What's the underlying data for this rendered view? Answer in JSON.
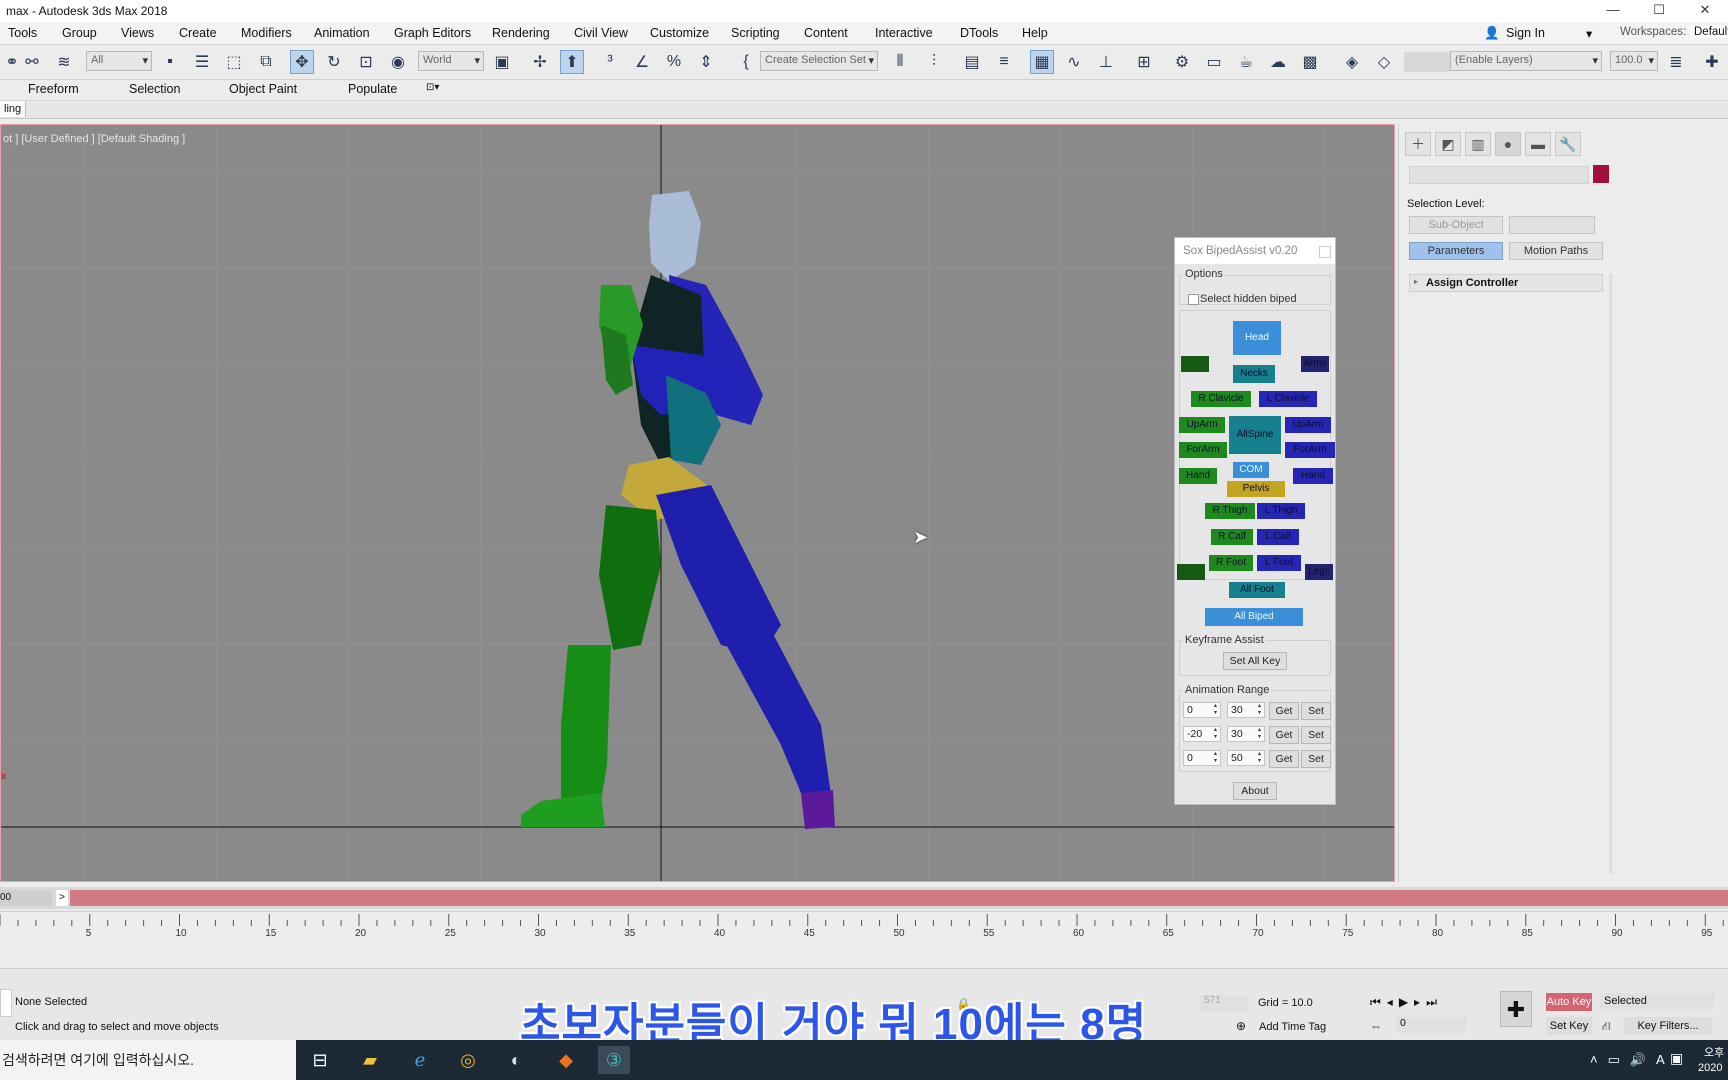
{
  "window": {
    "title": "max - Autodesk 3ds Max 2018"
  },
  "menubar": {
    "items": [
      "Tools",
      "Group",
      "Views",
      "Create",
      "Modifiers",
      "Animation",
      "Graph Editors",
      "Rendering",
      "Civil View",
      "Customize",
      "Scripting",
      "Content",
      "Interactive",
      "DTools",
      "Help"
    ],
    "sign_in": "Sign In",
    "workspaces_label": "Workspaces:",
    "workspaces_value": "Default"
  },
  "toolbar": {
    "filter_value": "All",
    "coord_value": "World",
    "selection_set_placeholder": "Create Selection Set",
    "layers_value": "(Enable Layers)",
    "layers_num": "100.0"
  },
  "ribbon": {
    "items": [
      "Freeform",
      "Selection",
      "Object Paint",
      "Populate"
    ],
    "tab": "ling"
  },
  "viewport": {
    "label": "ot ] [User Defined ] [Default Shading ]"
  },
  "biped_assist": {
    "title": "Sox BipedAssist v0.20",
    "options_label": "Options",
    "select_hidden": "Select hidden biped",
    "buttons": {
      "head": "Head",
      "neck": "Necks",
      "arms": "Arms",
      "r_clavicle": "R Clavicle",
      "l_clavicle": "L Clavicle",
      "r_uparm": "UpArm",
      "l_uparm": "UpArm",
      "allspine": "AllSpine",
      "r_forearm": "ForArm",
      "l_forearm": "ForArm",
      "r_hand": "Hand",
      "l_hand": "Hand",
      "com": "COM",
      "pelvis": "Pelvis",
      "r_thigh": "R Thigh",
      "l_thigh": "L Thigh",
      "r_calf": "R Calf",
      "l_calf": "L Calf",
      "r_foot": "R Foot",
      "l_foot": "L Foot",
      "legs": "Legs",
      "all_foot": "All Foot",
      "all_biped": "All Biped"
    },
    "keyframe_label": "Keyframe Assist",
    "set_all_key": "Set All Key",
    "anim_range_label": "Animation Range",
    "ranges": [
      {
        "start": "0",
        "end": "30"
      },
      {
        "start": "-20",
        "end": "30"
      },
      {
        "start": "0",
        "end": "50"
      }
    ],
    "get_label": "Get",
    "set_label": "Set",
    "about": "About"
  },
  "command_panel": {
    "selection_level": "Selection Level:",
    "sub_object": "Sub-Object",
    "parameters": "Parameters",
    "motion_paths": "Motion Paths",
    "assign_controller": "Assign Controller",
    "swatch_color": "#a0103a"
  },
  "timeline": {
    "slider_value": "00",
    "slider_arrow": ">",
    "ticks": [
      "5",
      "10",
      "15",
      "20",
      "25",
      "30",
      "35",
      "40",
      "45",
      "50",
      "55",
      "60",
      "65",
      "70",
      "75",
      "80",
      "85",
      "90",
      "95"
    ]
  },
  "status": {
    "none_selected": "None Selected",
    "hint": "Click and drag to select and move objects",
    "coord_z": "571",
    "grid": "Grid = 10.0",
    "add_time_tag": "Add Time Tag",
    "auto_key": "Auto Key",
    "set_key": "Set Key",
    "selected": "Selected",
    "key_filters": "Key Filters...",
    "frame": "0",
    "subtitle": "초보자분들이 거야 뭐 10에는 8명"
  },
  "taskbar": {
    "search": "검색하려면 여기에 입력하십시오.",
    "clock_top": "오후",
    "clock_bottom": "2020"
  }
}
